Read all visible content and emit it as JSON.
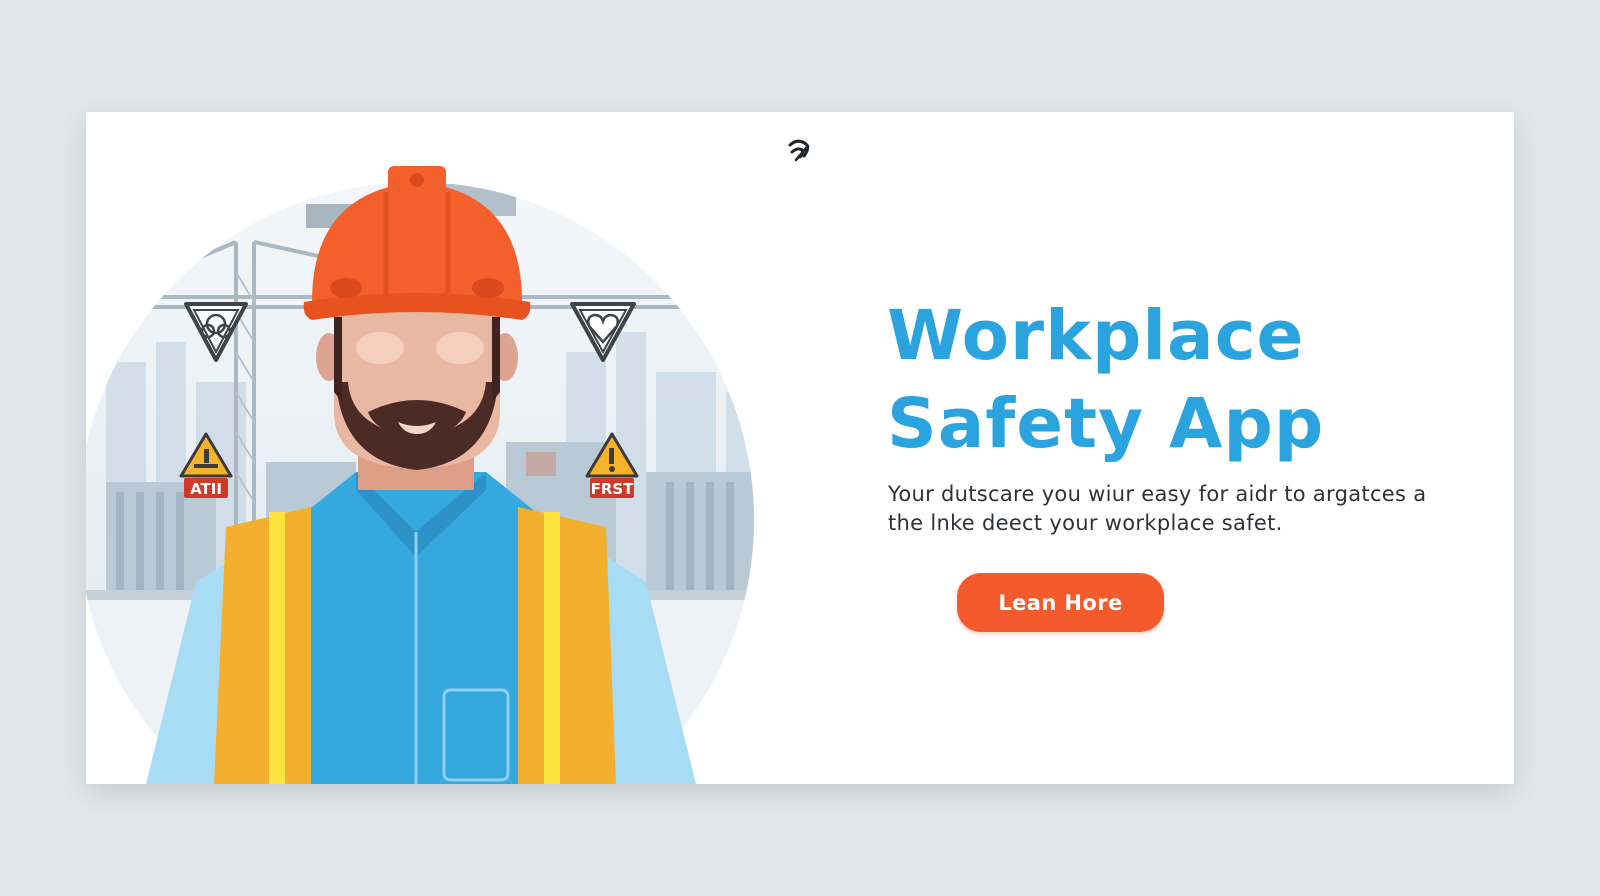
{
  "hero": {
    "headline_line1": "Workplace",
    "headline_line2": "Safety App",
    "subtitle_line1": "Your dutscare you wiur easy for aidr to argatces a",
    "subtitle_line2": "the lnke deect your workplace safet.",
    "cta_label": "Lean Hore"
  },
  "illustration": {
    "sign_left_label": "ATII",
    "sign_right_label": "FRST"
  },
  "colors": {
    "background": "#e3e7eb",
    "card": "#ffffff",
    "headline": "#2aa3df",
    "cta": "#f45a2b",
    "hard_hat": "#f4602c",
    "vest": "#f2b02e",
    "shirt": "#35a8e0"
  },
  "icons": [
    "brand-logo-icon",
    "shield-icon",
    "shield-heart-icon",
    "warning-icon"
  ]
}
